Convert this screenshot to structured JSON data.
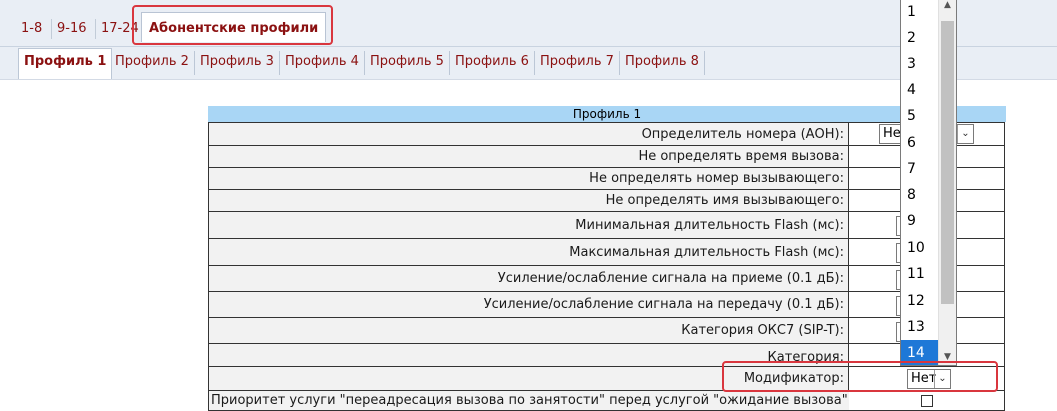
{
  "top_tabs": [
    {
      "label": "1-8"
    },
    {
      "label": "9-16"
    },
    {
      "label": "17-24"
    },
    {
      "label": "Абонентские профили"
    }
  ],
  "profile_tabs": [
    {
      "label": "Профиль 1"
    },
    {
      "label": "Профиль 2"
    },
    {
      "label": "Профиль 3"
    },
    {
      "label": "Профиль 4"
    },
    {
      "label": "Профиль 5"
    },
    {
      "label": "Профиль 6"
    },
    {
      "label": "Профиль 7"
    },
    {
      "label": "Профиль 8"
    }
  ],
  "form": {
    "header": "Профиль 1",
    "rows": [
      {
        "label": "Определитель номера (АОН):",
        "value": "Не"
      },
      {
        "label": "Не определять время вызова:"
      },
      {
        "label": "Не определять номер вызывающего:"
      },
      {
        "label": "Не определять имя вызывающего:"
      },
      {
        "label": "Минимальная длительность Flash (мс):"
      },
      {
        "label": "Максимальная длительность Flash (мс):"
      },
      {
        "label": "Усиление/ослабление сигнала на приеме (0.1 дБ):"
      },
      {
        "label": "Усиление/ослабление сигнала на передачу (0.1 дБ):"
      },
      {
        "label": "Категория ОКС7 (SIP-T):"
      },
      {
        "label": "Категория:"
      },
      {
        "label": "Модификатор:",
        "value": "Нет"
      },
      {
        "label": "Приоритет услуги \"переадресация вызова по занятости\" перед услугой \"ожидание вызова\":"
      }
    ]
  },
  "dropdown": {
    "options": [
      "1",
      "2",
      "3",
      "4",
      "5",
      "6",
      "7",
      "8",
      "9",
      "10",
      "11",
      "12",
      "13",
      "14"
    ],
    "selected": "14"
  },
  "icons": {
    "select_arrow": "chevron-down-icon",
    "scroll_up": "scroll-up-icon",
    "scroll_down": "scroll-down-icon"
  },
  "colors": {
    "tab_text": "#8b1111",
    "header_bg": "#a9d6f5",
    "highlight": "#d9363e",
    "selected_option": "#1e78d7"
  }
}
